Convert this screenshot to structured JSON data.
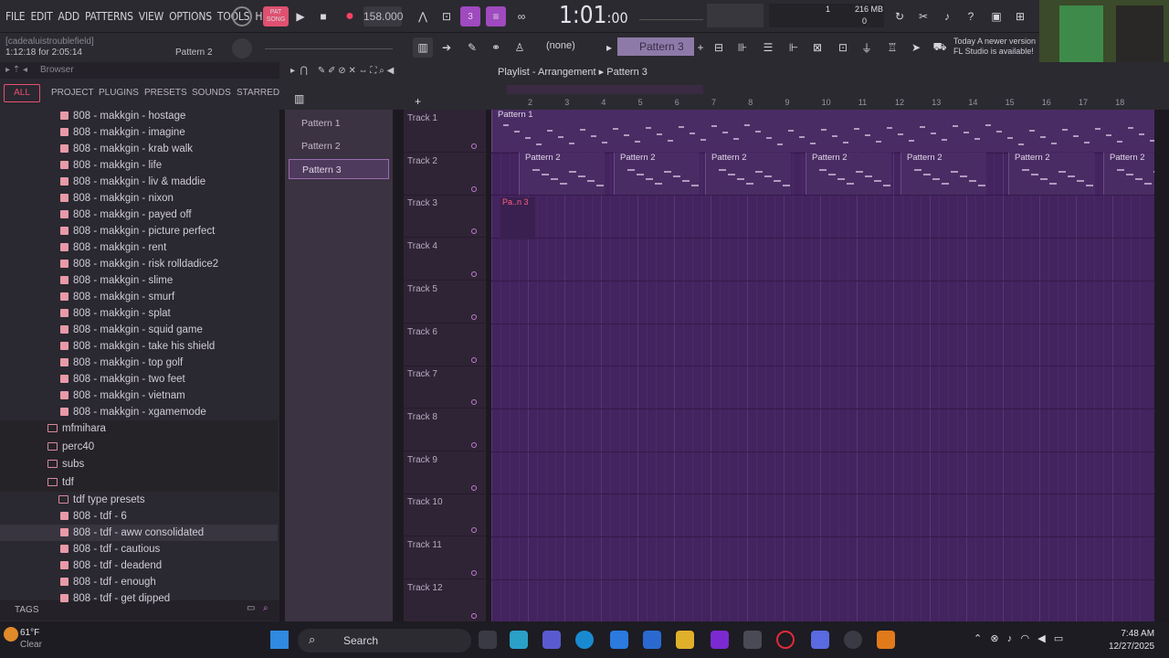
{
  "menu": [
    "FILE",
    "EDIT",
    "ADD",
    "PATTERNS",
    "VIEW",
    "OPTIONS",
    "TOOLS",
    "HELP"
  ],
  "transport": {
    "pat_song_label": "PAT SONG",
    "tempo": "158.000",
    "time": "1:01",
    "time_small": ":00",
    "memory": "216 MB",
    "mem_count": "1",
    "mem_zero": "0"
  },
  "hint": {
    "line1": "[cadealuistroublefield]",
    "line2": "1:12:18 for 2:05:14",
    "pattern": "Pattern 2"
  },
  "toolbar": {
    "snap": "(none)",
    "pattern_selector": "Pattern 3"
  },
  "notice": {
    "line1": "Today  A newer version",
    "line2": "FL Studio is available!"
  },
  "browser": {
    "title": "Browser",
    "tabs": [
      "ALL",
      "PROJECT",
      "PLUGINS",
      "PRESETS",
      "SOUNDS",
      "STARRED"
    ],
    "items": [
      {
        "label": "808 - makkgin - hostage",
        "type": "file"
      },
      {
        "label": "808 - makkgin - imagine",
        "type": "file"
      },
      {
        "label": "808 - makkgin - krab walk",
        "type": "file"
      },
      {
        "label": "808 - makkgin - life",
        "type": "file"
      },
      {
        "label": "808 - makkgin - liv & maddie",
        "type": "file"
      },
      {
        "label": "808 - makkgin - nixon",
        "type": "file"
      },
      {
        "label": "808 - makkgin - payed off",
        "type": "file"
      },
      {
        "label": "808 - makkgin - picture perfect",
        "type": "file"
      },
      {
        "label": "808 - makkgin - rent",
        "type": "file"
      },
      {
        "label": "808 - makkgin - risk rolldadice2",
        "type": "file"
      },
      {
        "label": "808 - makkgin - slime",
        "type": "file"
      },
      {
        "label": "808 - makkgin - smurf",
        "type": "file"
      },
      {
        "label": "808 - makkgin - splat",
        "type": "file"
      },
      {
        "label": "808 - makkgin - squid game",
        "type": "file"
      },
      {
        "label": "808 - makkgin - take his shield",
        "type": "file"
      },
      {
        "label": "808 - makkgin - top golf",
        "type": "file"
      },
      {
        "label": "808 - makkgin - two feet",
        "type": "file"
      },
      {
        "label": "808 - makkgin - vietnam",
        "type": "file"
      },
      {
        "label": "808 - makkgin - xgamemode",
        "type": "file"
      },
      {
        "label": "mfmihara",
        "type": "folder"
      },
      {
        "label": "perc40",
        "type": "folder"
      },
      {
        "label": "subs",
        "type": "folder"
      },
      {
        "label": "tdf",
        "type": "folder"
      },
      {
        "label": "tdf type presets",
        "type": "subfolder"
      },
      {
        "label": "808 - tdf - 6",
        "type": "file"
      },
      {
        "label": "808 - tdf - aww consolidated",
        "type": "file"
      },
      {
        "label": "808 - tdf - cautious",
        "type": "file"
      },
      {
        "label": "808 - tdf - deadend",
        "type": "file"
      },
      {
        "label": "808 - tdf - enough",
        "type": "file"
      },
      {
        "label": "808 - tdf - get dipped",
        "type": "file"
      }
    ],
    "tags": "TAGS"
  },
  "playlist": {
    "title": "Playlist - Arrangement",
    "current_pattern": "Pattern 3",
    "patterns": [
      "Pattern 1",
      "Pattern 2",
      "Pattern 3"
    ],
    "tracks": [
      "Track 1",
      "Track 2",
      "Track 3",
      "Track 4",
      "Track 5",
      "Track 6",
      "Track 7",
      "Track 8",
      "Track 9",
      "Track 10",
      "Track 11",
      "Track 12"
    ],
    "ruler": [
      "2",
      "3",
      "4",
      "5",
      "6",
      "7",
      "8",
      "9",
      "10",
      "11",
      "12",
      "13",
      "14",
      "15",
      "16",
      "17",
      "18"
    ],
    "clip_track1": "Pattern 1",
    "clip_track2": "Pattern 2",
    "clip_track3": "Pa..n 3"
  },
  "taskbar": {
    "temp": "61°F",
    "weather": "Clear",
    "search": "Search",
    "time": "7:48 AM",
    "date": "12/27/2025"
  }
}
